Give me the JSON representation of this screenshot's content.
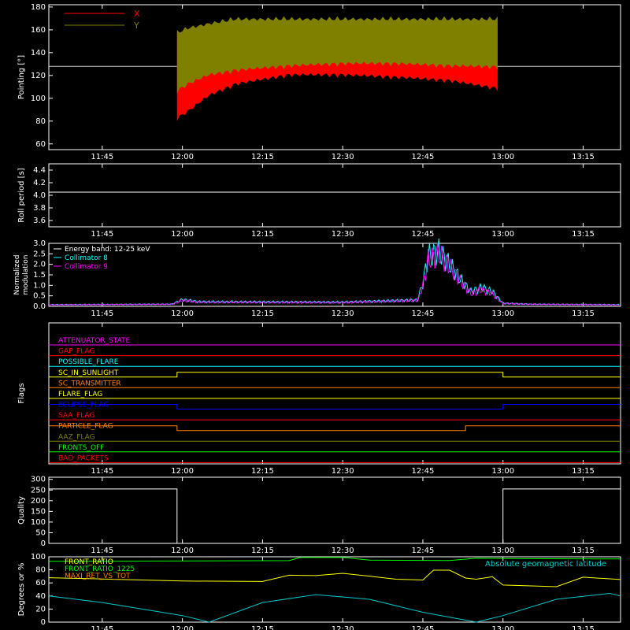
{
  "figure": {
    "background": "#000000",
    "axis_color": "#ffffff"
  },
  "time_ticks": [
    "11:45",
    "12:00",
    "12:15",
    "12:30",
    "12:45",
    "13:00",
    "13:15"
  ],
  "chart_data": [
    {
      "id": "pointing",
      "type": "area",
      "ylabel": "Pointing [°]",
      "ylim": [
        55,
        182
      ],
      "yticks": [
        60,
        80,
        100,
        120,
        140,
        160,
        180
      ],
      "reference_line": {
        "y": 128,
        "color": "#c8c8c8"
      },
      "legend": [
        "X",
        "Y"
      ],
      "series": [
        {
          "name": "X",
          "color": "#ff0000",
          "x": [
            "11:59",
            "12:01",
            "12:05",
            "12:10",
            "12:20",
            "12:30",
            "12:40",
            "12:50",
            "12:59"
          ],
          "upper": [
            158,
            164,
            168,
            170,
            171,
            171,
            170,
            168,
            166
          ],
          "lower": [
            80,
            86,
            100,
            110,
            118,
            118,
            116,
            113,
            106
          ]
        },
        {
          "name": "Y",
          "color": "#808000",
          "x": [
            "11:59",
            "12:01",
            "12:05",
            "12:10",
            "12:20",
            "12:30",
            "12:40",
            "12:50",
            "12:59"
          ],
          "upper": [
            160,
            164,
            168,
            172,
            172,
            172,
            172,
            172,
            172
          ],
          "lower": [
            104,
            110,
            118,
            122,
            126,
            128,
            128,
            126,
            125
          ]
        }
      ]
    },
    {
      "id": "roll",
      "type": "line",
      "ylabel": "Roll period [s]",
      "ylim": [
        3.5,
        4.5
      ],
      "yticks": [
        "3.6",
        "3.8",
        "4.0",
        "4.2",
        "4.4"
      ],
      "series": [
        {
          "name": "",
          "color": "#ffffff",
          "x": [
            "11:35",
            "13:22"
          ],
          "y": [
            4.05,
            4.05
          ]
        }
      ]
    },
    {
      "id": "modulation",
      "type": "line",
      "ylabel": "Normalized modulation",
      "ylim": [
        0,
        3
      ],
      "yticks": [
        "0.0",
        "0.5",
        "1.0",
        "1.5",
        "2.0",
        "2.5",
        "3.0"
      ],
      "legend": [
        "Energy band: 12-25 keV",
        "Collimator 8",
        "Collimator 9"
      ],
      "series": [
        {
          "name": "Collimator 8",
          "color": "#00ffff",
          "x": [
            "11:35",
            "11:58",
            "12:00",
            "12:03",
            "12:30",
            "12:44",
            "12:45",
            "12:46",
            "12:48",
            "12:50",
            "12:52",
            "12:54",
            "12:56",
            "12:58",
            "13:00",
            "13:05",
            "13:22"
          ],
          "y": [
            0.08,
            0.1,
            0.32,
            0.22,
            0.2,
            0.3,
            1.1,
            2.4,
            2.6,
            2.0,
            1.3,
            0.7,
            0.9,
            0.7,
            0.15,
            0.1,
            0.08
          ]
        },
        {
          "name": "Collimator 9",
          "color": "#ff00ff",
          "x": [
            "11:35",
            "11:58",
            "12:00",
            "12:03",
            "12:30",
            "12:44",
            "12:45",
            "12:46",
            "12:48",
            "12:50",
            "12:52",
            "12:54",
            "12:56",
            "12:58",
            "13:00",
            "13:05",
            "13:22"
          ],
          "y": [
            0.07,
            0.1,
            0.28,
            0.2,
            0.18,
            0.28,
            1.0,
            2.2,
            2.5,
            1.9,
            1.2,
            0.6,
            0.8,
            0.6,
            0.14,
            0.1,
            0.07
          ]
        }
      ]
    },
    {
      "id": "flags",
      "type": "line",
      "ylabel": "Flags",
      "series": [
        {
          "name": "ATTENUATOR_STATE",
          "color": "#ff00ff",
          "segments": [
            [
              "11:35",
              "13:22",
              0
            ]
          ]
        },
        {
          "name": "GAP_FLAG",
          "color": "#ff0000",
          "segments": [
            [
              "11:35",
              "13:22",
              0
            ]
          ]
        },
        {
          "name": "POSSIBLE_FLARE",
          "color": "#00ffff",
          "segments": [
            [
              "11:35",
              "13:22",
              0
            ]
          ]
        },
        {
          "name": "SC_IN_SUNLIGHT",
          "color": "#ffff00",
          "segments": [
            [
              "11:35",
              "11:59",
              0
            ],
            [
              "11:59",
              "13:00",
              1
            ],
            [
              "13:00",
              "13:22",
              0
            ]
          ]
        },
        {
          "name": "SC_TRANSMITTER",
          "color": "#ff8000",
          "segments": [
            [
              "11:35",
              "13:22",
              0
            ]
          ]
        },
        {
          "name": "FLARE_FLAG",
          "color": "#ffff00",
          "segments": [
            [
              "11:35",
              "13:22",
              0
            ]
          ]
        },
        {
          "name": "ECLIPSE_FLAG",
          "color": "#0000ff",
          "segments": [
            [
              "11:35",
              "11:59",
              1
            ],
            [
              "11:59",
              "13:00",
              0
            ],
            [
              "13:00",
              "13:22",
              1
            ]
          ]
        },
        {
          "name": "SAA_FLAG",
          "color": "#ff0000",
          "segments": [
            [
              "11:35",
              "13:22",
              0
            ]
          ]
        },
        {
          "name": "PARTICLE_FLAG",
          "color": "#ff8000",
          "segments": [
            [
              "11:35",
              "11:59",
              1
            ],
            [
              "11:59",
              "12:53",
              0
            ],
            [
              "12:53",
              "13:22",
              1
            ]
          ]
        },
        {
          "name": "AAZ_FLAG",
          "color": "#808000",
          "segments": [
            [
              "11:35",
              "13:22",
              0
            ]
          ]
        },
        {
          "name": "FRONTS_OFF",
          "color": "#00ff00",
          "segments": [
            [
              "11:35",
              "13:22",
              0
            ]
          ]
        },
        {
          "name": "BAD_PACKETS",
          "color": "#ff0000",
          "segments": [
            [
              "11:35",
              "13:22",
              0
            ]
          ]
        }
      ]
    },
    {
      "id": "quality",
      "type": "line",
      "ylabel": "Quality",
      "ylim": [
        0,
        310
      ],
      "yticks": [
        0,
        50,
        100,
        150,
        200,
        250,
        300
      ],
      "series": [
        {
          "name": "",
          "color": "#ffffff",
          "x": [
            "11:35",
            "11:59",
            "11:59",
            "13:00",
            "13:00",
            "13:22"
          ],
          "y": [
            255,
            255,
            0,
            0,
            255,
            255
          ]
        }
      ]
    },
    {
      "id": "ratios",
      "type": "line",
      "ylabel": "Degrees or %",
      "ylim": [
        0,
        100
      ],
      "yticks": [
        0,
        20,
        40,
        60,
        80,
        100
      ],
      "legend": [
        "FRONT_RATIO",
        "FRONT_RATIO_1225",
        "MAXI_RET_VS_TOT",
        "Absolute geomagnetic latitude"
      ],
      "series": [
        {
          "name": "FRONT_RATIO",
          "color": "#ffff00",
          "x": [
            "11:35",
            "11:45",
            "12:00",
            "12:15",
            "12:20",
            "12:25",
            "12:30",
            "12:35",
            "12:40",
            "12:45",
            "12:47",
            "12:50",
            "12:53",
            "12:55",
            "12:58",
            "13:00",
            "13:10",
            "13:15",
            "13:22"
          ],
          "y": [
            68,
            66,
            63,
            62,
            72,
            71,
            75,
            70,
            66,
            64,
            80,
            79,
            68,
            65,
            70,
            56,
            55,
            68,
            66
          ]
        },
        {
          "name": "FRONT_RATIO_1225",
          "color": "#00ff00",
          "x": [
            "11:35",
            "12:20",
            "12:22",
            "12:30",
            "12:35",
            "12:50",
            "12:55",
            "13:00",
            "13:22"
          ],
          "y": [
            93,
            94,
            99,
            99,
            95,
            94,
            98,
            97,
            97
          ]
        },
        {
          "name": "Absolute geomagnetic latitude",
          "color": "#00c8c8",
          "x": [
            "11:35",
            "11:45",
            "12:00",
            "12:05",
            "12:15",
            "12:25",
            "12:35",
            "12:45",
            "12:55",
            "13:00",
            "13:10",
            "13:20",
            "13:22"
          ],
          "y": [
            40,
            30,
            10,
            0,
            30,
            42,
            35,
            15,
            0,
            10,
            35,
            44,
            40
          ]
        }
      ]
    }
  ]
}
